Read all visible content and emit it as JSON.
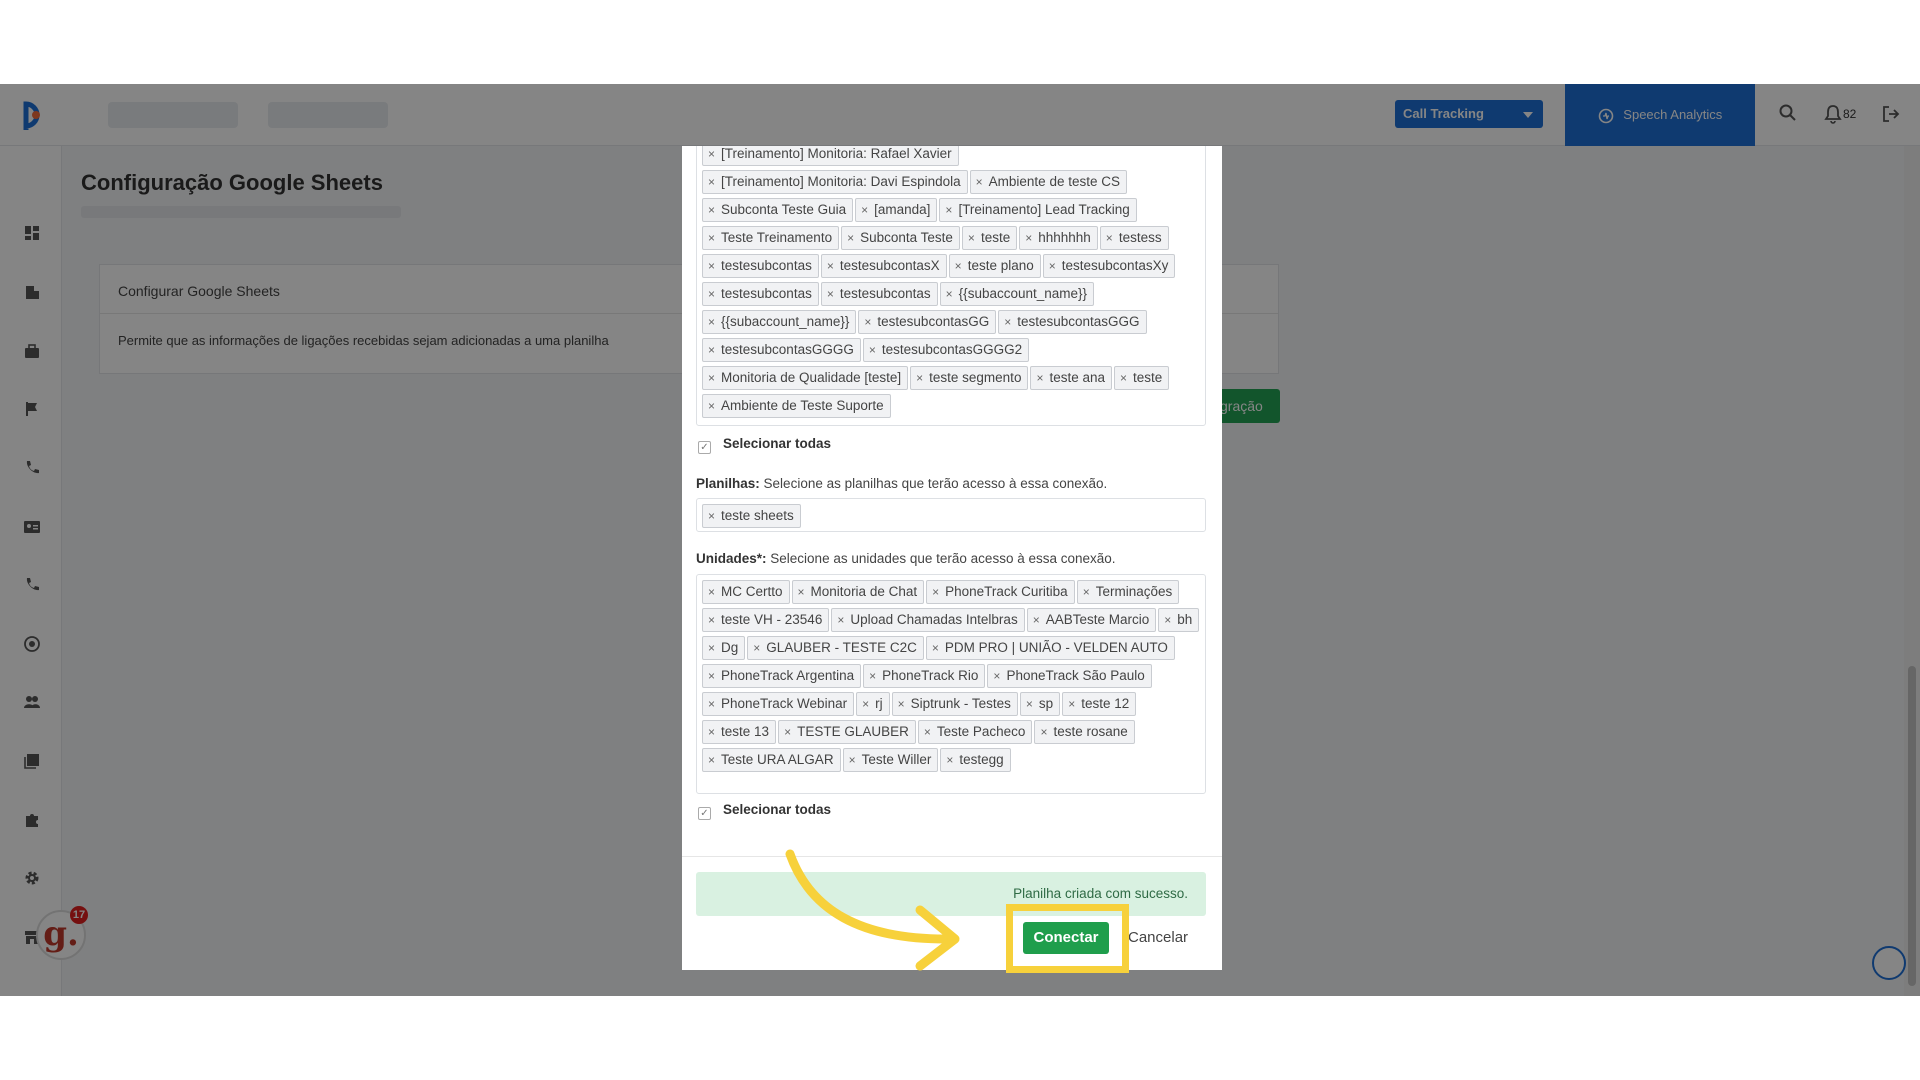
{
  "header": {
    "call_tracking_label": "Call Tracking",
    "speech_analytics_label": "Speech Analytics",
    "notifications_count": "82"
  },
  "page": {
    "title": "Configuração Google Sheets",
    "card_title": "Configurar Google Sheets",
    "card_description": "Permite que as informações de ligações recebidas sejam adicionadas a uma planilha",
    "add_button_label": "gração"
  },
  "modal": {
    "accounts": [
      "[Treinamento] Monitoria: Rafael Xavier",
      "[Treinamento] Monitoria: Davi Espindola",
      "Ambiente de teste CS",
      "Subconta Teste Guia",
      "[amanda]",
      "[Treinamento] Lead Tracking",
      "Teste Treinamento",
      "Subconta Teste",
      "teste",
      "hhhhhhh",
      "testess",
      "testesubcontas",
      "testesubcontasX",
      "teste plano",
      "testesubcontasXy",
      "testesubcontas",
      "testesubcontas",
      "{{subaccount_name}}",
      "{{subaccount_name}}",
      "testesubcontasGG",
      "testesubcontasGGG",
      "testesubcontasGGGG",
      "testesubcontasGGGG2",
      "Monitoria de Qualidade [teste]",
      "teste segmento",
      "teste ana",
      "teste",
      "Ambiente de Teste Suporte"
    ],
    "select_all_label": "Selecionar todas",
    "sheets_label_bold": "Planilhas:",
    "sheets_label_text": "Selecione as planilhas que terão acesso à essa conexão.",
    "sheets": [
      "teste sheets"
    ],
    "units_label_bold": "Unidades*:",
    "units_label_text": "Selecione as unidades que terão acesso à essa conexão.",
    "units": [
      "MC Certto",
      "Monitoria de Chat",
      "PhoneTrack Curitiba",
      "Terminações",
      "teste VH - 23546",
      "Upload Chamadas Intelbras",
      "AABTeste Marcio",
      "bh",
      "Dg",
      "GLAUBER - TESTE C2C",
      "PDM PRO | UNIÃO - VELDEN AUTO",
      "PhoneTrack Argentina",
      "PhoneTrack Rio",
      "PhoneTrack São Paulo",
      "PhoneTrack Webinar",
      "rj",
      "Siptrunk - Testes",
      "sp",
      "teste 12",
      "teste 13",
      "TESTE GLAUBER",
      "Teste Pacheco",
      "teste rosane",
      "Teste URA ALGAR",
      "Teste Willer",
      "testegg"
    ],
    "success_message": "Planilha criada com sucesso.",
    "connect_label": "Conectar",
    "cancel_label": "Cancelar"
  },
  "widget": {
    "gleap_letter": "g.",
    "gleap_badge": "17"
  }
}
